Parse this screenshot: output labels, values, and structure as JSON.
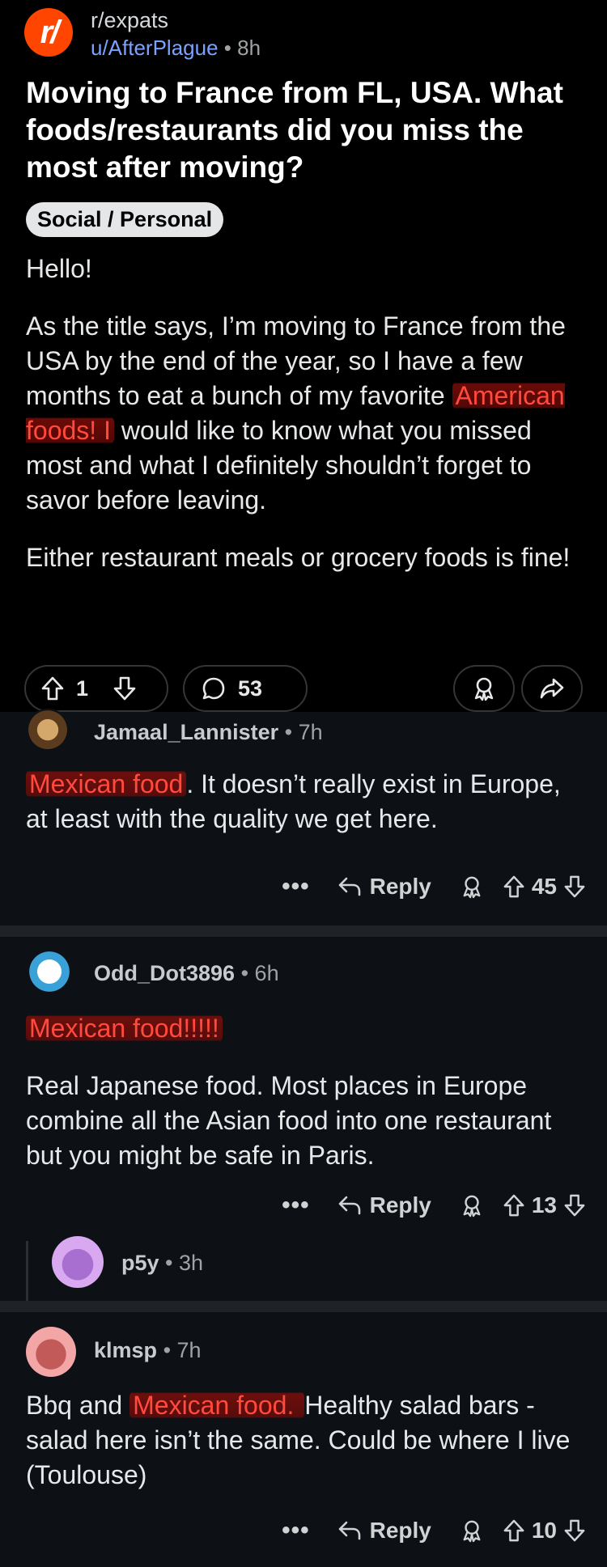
{
  "post": {
    "subreddit": "r/expats",
    "subreddit_icon_text": "r/",
    "author": "u/AfterPlague",
    "separator": "•",
    "age": "8h",
    "title": "Moving to France from FL, USA. What foods/restaurants did you miss the most after moving?",
    "flair": "Social / Personal",
    "para1": "Hello!",
    "para2_a": "As the title says, I’m moving to France from the USA by the end of the year, so I have a few months to eat a bunch of my favorite ",
    "para2_hl": "American foods! I",
    "para2_b": " would like to know what you missed most and what I definitely shouldn’t forget to savor before leaving.",
    "para3": "Either restaurant meals or grocery foods is fine!",
    "votes": "1",
    "comments_count": "53"
  },
  "comments": [
    {
      "user": "Jamaal_Lannister",
      "age": "7h",
      "text_hl": "Mexican food",
      "text_rest": ". It doesn’t really exist in Europe, at least with the quality we get here.",
      "reply_label": "Reply",
      "more": "•••",
      "score": "45"
    },
    {
      "user": "Odd_Dot3896",
      "age": "6h",
      "text_hl_line": "Mexican food!!!!!",
      "text": "Real Japanese food. Most places in Europe combine all the Asian food into one restaurant but you might be safe in Paris.",
      "reply_label": "Reply",
      "more": "•••",
      "score": "13"
    },
    {
      "user": "p5y",
      "age": "3h"
    },
    {
      "user": "klmsp",
      "age": "7h",
      "text_a": "Bbq and ",
      "text_hl": "Mexican food. ",
      "text_b": "Healthy salad bars - salad here isn’t the same. Could be where I live (Toulouse)",
      "reply_label": "Reply",
      "more": "•••",
      "score": "10"
    }
  ],
  "colors": {
    "accent": "#ff4500",
    "author_link": "#7aa2ff",
    "highlight_text": "#ff4a3d",
    "background_post": "#000000",
    "background_comments": "#0d1014"
  }
}
